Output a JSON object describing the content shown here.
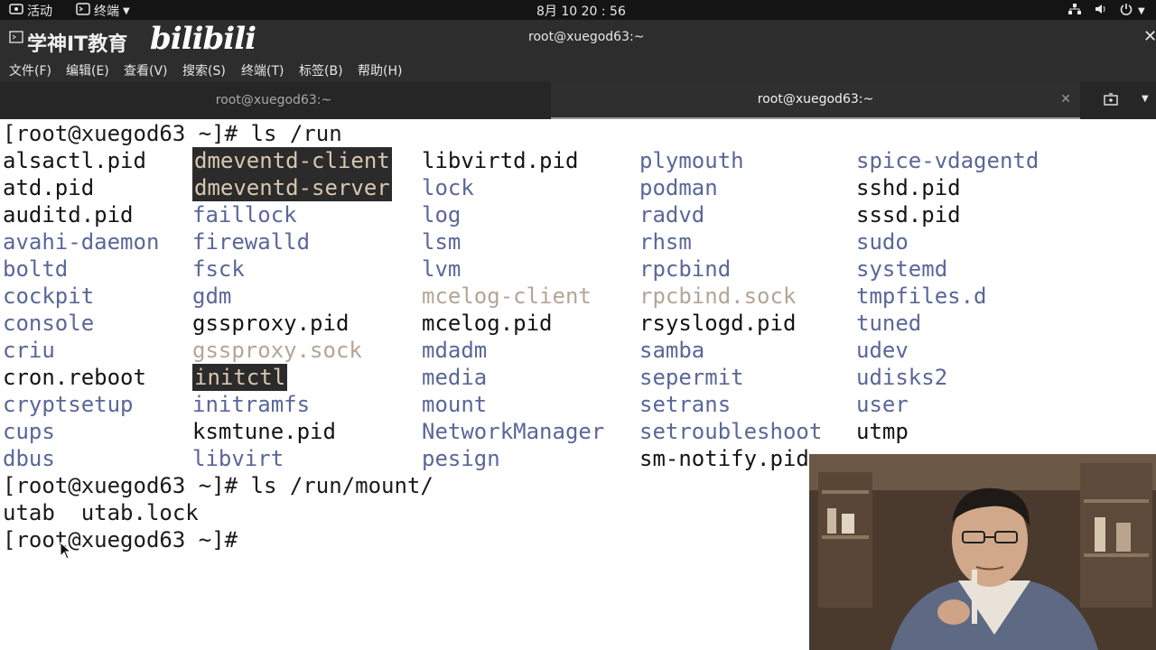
{
  "topbar": {
    "activities": "活动",
    "terminal_app": "终端",
    "clock": "8月 10 20 : 56"
  },
  "titlebar": {
    "logo_text": "学神IT教育",
    "bilibili": "bilibili",
    "title": "root@xuegod63:~"
  },
  "menu": {
    "file": "文件(F)",
    "edit": "编辑(E)",
    "view": "查看(V)",
    "search": "搜索(S)",
    "terminal": "终端(T)",
    "tabs": "标签(B)",
    "help": "帮助(H)"
  },
  "tabs": [
    {
      "label": "root@xuegod63:~"
    },
    {
      "label": "root@xuegod63:~"
    }
  ],
  "terminal": {
    "cmd1": "[root@xuegod63 ~]# ls /run",
    "cmd2": "[root@xuegod63 ~]# ls /run/mount/",
    "out2": "utab  utab.lock",
    "prompt3": "[root@xuegod63 ~]#",
    "columns": [
      [
        {
          "name": "alsactl.pid",
          "type": "file"
        },
        {
          "name": "atd.pid",
          "type": "file"
        },
        {
          "name": "auditd.pid",
          "type": "file"
        },
        {
          "name": "avahi-daemon",
          "type": "dir"
        },
        {
          "name": "boltd",
          "type": "dir"
        },
        {
          "name": "cockpit",
          "type": "dir"
        },
        {
          "name": "console",
          "type": "dir"
        },
        {
          "name": "criu",
          "type": "dir"
        },
        {
          "name": "cron.reboot",
          "type": "file"
        },
        {
          "name": "cryptsetup",
          "type": "dir"
        },
        {
          "name": "cups",
          "type": "dir"
        },
        {
          "name": "dbus",
          "type": "dir"
        }
      ],
      [
        {
          "name": "dmeventd-client",
          "type": "hl"
        },
        {
          "name": "dmeventd-server",
          "type": "hl"
        },
        {
          "name": "faillock",
          "type": "dir"
        },
        {
          "name": "firewalld",
          "type": "dir"
        },
        {
          "name": "fsck",
          "type": "dir"
        },
        {
          "name": "gdm",
          "type": "dir"
        },
        {
          "name": "gssproxy.pid",
          "type": "file"
        },
        {
          "name": "gssproxy.sock",
          "type": "sock"
        },
        {
          "name": "initctl",
          "type": "hl"
        },
        {
          "name": "initramfs",
          "type": "dir"
        },
        {
          "name": "ksmtune.pid",
          "type": "file"
        },
        {
          "name": "libvirt",
          "type": "dir"
        }
      ],
      [
        {
          "name": "libvirtd.pid",
          "type": "file"
        },
        {
          "name": "lock",
          "type": "dir"
        },
        {
          "name": "log",
          "type": "dir"
        },
        {
          "name": "lsm",
          "type": "dir"
        },
        {
          "name": "lvm",
          "type": "dir"
        },
        {
          "name": "mcelog-client",
          "type": "sock"
        },
        {
          "name": "mcelog.pid",
          "type": "file"
        },
        {
          "name": "mdadm",
          "type": "dir"
        },
        {
          "name": "media",
          "type": "dir"
        },
        {
          "name": "mount",
          "type": "dir"
        },
        {
          "name": "NetworkManager",
          "type": "dir"
        },
        {
          "name": "pesign",
          "type": "dir"
        }
      ],
      [
        {
          "name": "plymouth",
          "type": "dir"
        },
        {
          "name": "podman",
          "type": "dir"
        },
        {
          "name": "radvd",
          "type": "dir"
        },
        {
          "name": "rhsm",
          "type": "dir"
        },
        {
          "name": "rpcbind",
          "type": "dir"
        },
        {
          "name": "rpcbind.sock",
          "type": "sock"
        },
        {
          "name": "rsyslogd.pid",
          "type": "file"
        },
        {
          "name": "samba",
          "type": "dir"
        },
        {
          "name": "sepermit",
          "type": "dir"
        },
        {
          "name": "setrans",
          "type": "dir"
        },
        {
          "name": "setroubleshoot",
          "type": "dir"
        },
        {
          "name": "sm-notify.pid",
          "type": "file"
        }
      ],
      [
        {
          "name": "spice-vdagentd",
          "type": "dir"
        },
        {
          "name": "sshd.pid",
          "type": "file"
        },
        {
          "name": "sssd.pid",
          "type": "file"
        },
        {
          "name": "sudo",
          "type": "dir"
        },
        {
          "name": "systemd",
          "type": "dir"
        },
        {
          "name": "tmpfiles.d",
          "type": "dir"
        },
        {
          "name": "tuned",
          "type": "dir"
        },
        {
          "name": "udev",
          "type": "dir"
        },
        {
          "name": "udisks2",
          "type": "dir"
        },
        {
          "name": "user",
          "type": "dir"
        },
        {
          "name": "utmp",
          "type": "file"
        }
      ]
    ]
  },
  "colors": {
    "dir": "#5a6798",
    "file": "#141414",
    "sock": "#b4a596",
    "highlight_bg": "#2b2b2b"
  }
}
